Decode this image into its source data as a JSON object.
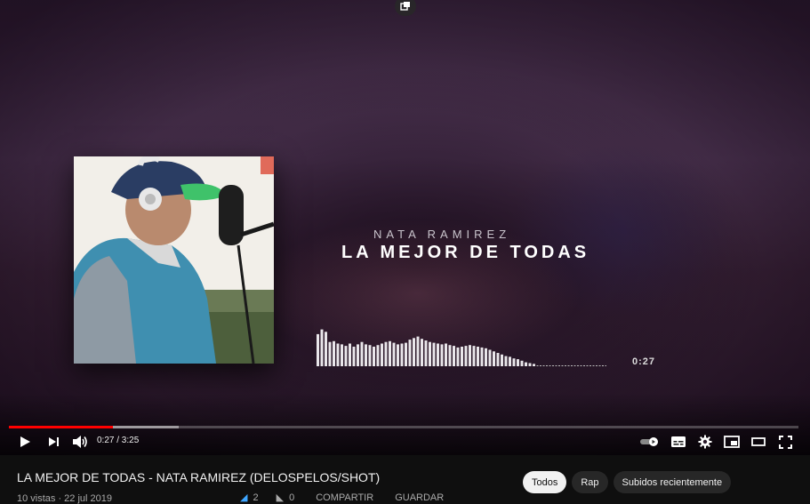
{
  "video": {
    "artist_text": "NATA RAMIREZ",
    "song_text": "LA MEJOR DE TODAS",
    "visualizer_time": "0:27",
    "current_time": "0:27",
    "duration": "3:25",
    "progress_fraction": 0.132,
    "buffered_fraction": 0.215,
    "visualizer_levels": [
      0.82,
      0.94,
      0.88,
      0.62,
      0.64,
      0.58,
      0.56,
      0.52,
      0.58,
      0.5,
      0.56,
      0.62,
      0.56,
      0.54,
      0.5,
      0.54,
      0.58,
      0.62,
      0.64,
      0.6,
      0.56,
      0.58,
      0.6,
      0.68,
      0.72,
      0.76,
      0.7,
      0.66,
      0.62,
      0.6,
      0.58,
      0.56,
      0.58,
      0.54,
      0.52,
      0.48,
      0.5,
      0.52,
      0.54,
      0.52,
      0.5,
      0.48,
      0.46,
      0.42,
      0.38,
      0.34,
      0.3,
      0.26,
      0.24,
      0.2,
      0.18,
      0.14,
      0.1,
      0.08,
      0.06
    ]
  },
  "controls": {
    "time_display": "0:27 / 3:25"
  },
  "info": {
    "title": "LA MEJOR DE TODAS - NATA RAMIREZ (DELOSPELOS/SHOT)",
    "stats": "10 vistas · 22 jul 2019",
    "likes": "2",
    "dislikes": "0",
    "share_label": "COMPARTIR",
    "save_label": "GUARDAR"
  },
  "chips": [
    "Todos",
    "Rap",
    "Subidos recientemente"
  ],
  "colors": {
    "progress": "#ff0000",
    "background": "#0f0f0f",
    "chip_active": "#f1f1f1",
    "chip": "#272727"
  }
}
